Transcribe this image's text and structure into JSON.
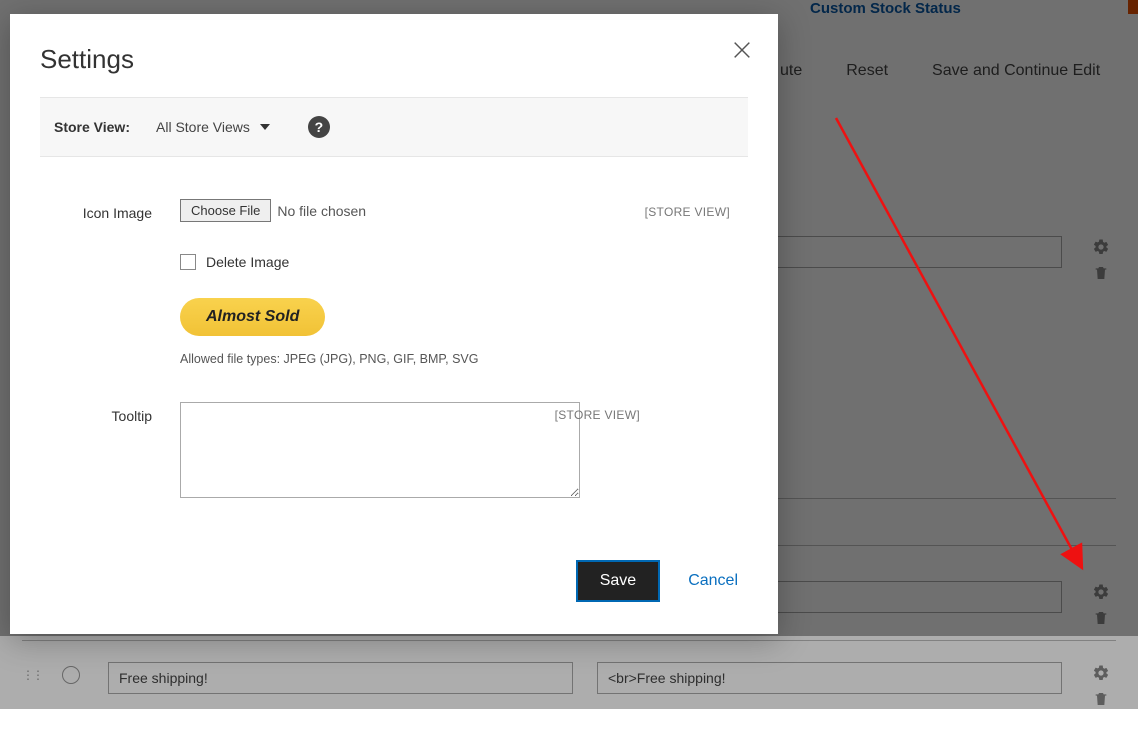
{
  "background": {
    "top_link_text": "Custom Stock Status",
    "buttons": {
      "delete_attr": "ute",
      "reset": "Reset",
      "save_continue": "Save and Continue Edit"
    },
    "rows": [
      {
        "col1": "",
        "col2": ""
      },
      {
        "col1": "",
        "col2": ""
      },
      {
        "col1": "Free shipping!",
        "col2": "<br>Free shipping!"
      }
    ]
  },
  "modal": {
    "title": "Settings",
    "storeview": {
      "label": "Store View:",
      "value": "All Store Views"
    },
    "help_glyph": "?",
    "icon_image": {
      "label": "Icon Image",
      "choose_file": "Choose File",
      "no_file": "No file chosen",
      "scope": "[STORE VIEW]",
      "delete_label": "Delete Image",
      "badge_text": "Almost Sold",
      "allowed_hint": "Allowed file types: JPEG (JPG), PNG, GIF, BMP, SVG"
    },
    "tooltip": {
      "label": "Tooltip",
      "value": "",
      "scope": "[STORE VIEW]"
    },
    "actions": {
      "save": "Save",
      "cancel": "Cancel"
    }
  }
}
